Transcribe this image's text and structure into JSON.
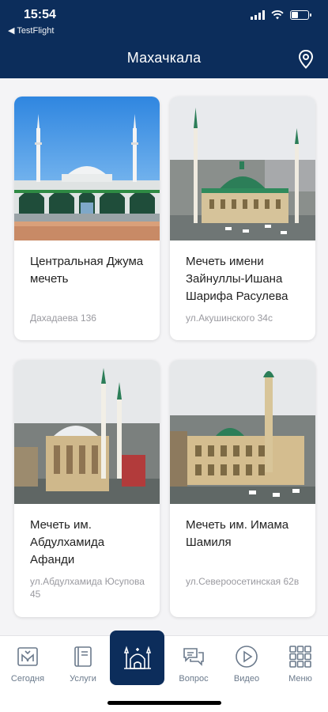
{
  "status_bar": {
    "time": "15:54",
    "back_app": "◀ TestFlight"
  },
  "header": {
    "title": "Махачкала",
    "location_icon": "location-pin-icon"
  },
  "mosques": [
    {
      "name": "Центральная Джума мечеть",
      "address": "Дахадаева 136"
    },
    {
      "name": "Мечеть имени Зайнуллы-Ишана Шарифа Расулева",
      "address": "ул.Акушинского 34с"
    },
    {
      "name": "Мечеть им. Абдулхамида Афанди",
      "address": "ул.Абдулхамида Юсупова 45"
    },
    {
      "name": "Мечеть им. Имама Шамиля",
      "address": "ул.Североосетинская 62в"
    }
  ],
  "tabs": {
    "today": "Сегодня",
    "services": "Услуги",
    "mosques_icon": "mosque-icon",
    "question": "Вопрос",
    "video": "Видео",
    "menu": "Меню"
  },
  "colors": {
    "primary": "#0c2d5b",
    "tab_icon": "#6b7a8c"
  }
}
